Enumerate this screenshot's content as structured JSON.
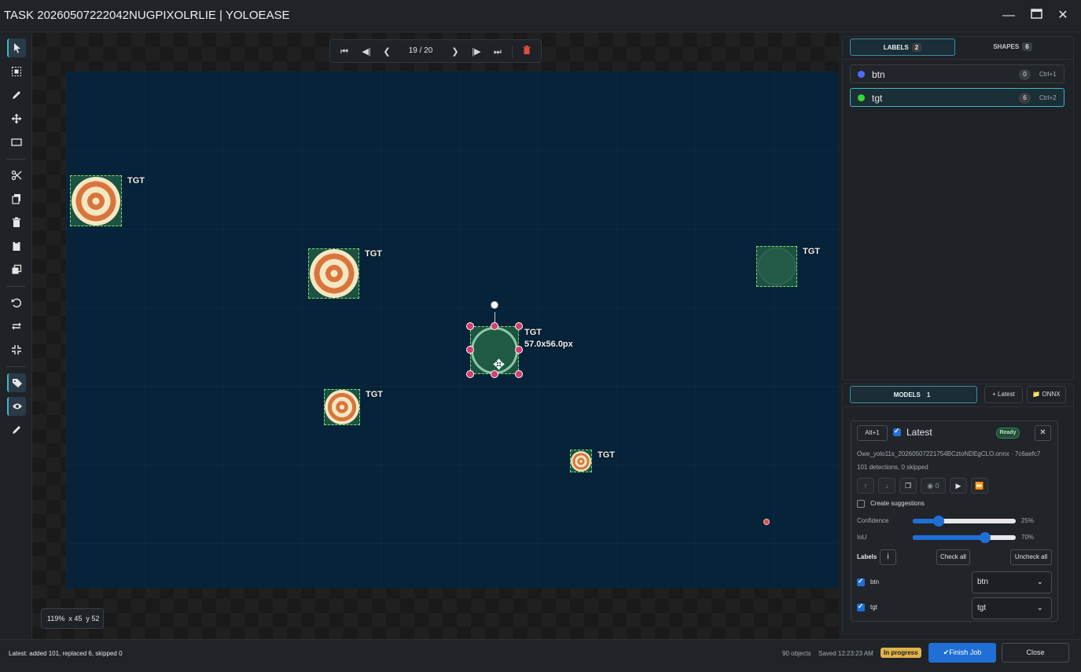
{
  "window": {
    "title": "TASK 20260507222042NUGPIXOLRLIE | YOLOEASE",
    "minimize_icon": "minimize-icon",
    "maximize_icon": "maximize-icon",
    "close_icon": "close-icon"
  },
  "toolbar": {
    "tools": [
      "pointer-tool",
      "select-area-tool",
      "draw-tool",
      "move-tool",
      "rectangle-tool",
      "cut-tool",
      "copy-tool",
      "delete-tool",
      "paste-tool",
      "duplicate-tool",
      "undo-tool",
      "redo-tool",
      "fit-tool",
      "labels-toggle",
      "visibility-toggle",
      "brush-tool"
    ]
  },
  "navigator": {
    "counter": "19 / 20"
  },
  "canvas": {
    "selected_size": "57.0x56.0px",
    "zoom": {
      "percent": "119%",
      "x": "x 45",
      "y": "y 52"
    },
    "annotations": [
      "TGT",
      "TGT",
      "TGT",
      "TGT",
      "TGT",
      "TGT"
    ]
  },
  "labels_panel": {
    "tabs": [
      {
        "label": "LABELS",
        "count": "2"
      },
      {
        "label": "SHAPES",
        "count": "6"
      }
    ],
    "items": [
      {
        "name": "btn",
        "count": "0",
        "shortcut": "Ctrl+1",
        "color": "#4f6bff"
      },
      {
        "name": "tgt",
        "count": "6",
        "shortcut": "Ctrl+2",
        "color": "#35d635"
      }
    ]
  },
  "models_panel": {
    "tab": {
      "label": "MODELS",
      "count": "1"
    },
    "latest_button": "+ Latest",
    "onnx_button": "ONNX",
    "card": {
      "shortcut": "Alt+1",
      "name": "Latest",
      "status": "Ready",
      "file": "Owe_yolo11s_20260507221754BCztoNDEgCLO.onnx · 7c6aefc7",
      "stats": "101 detections, 0 skipped",
      "hidden_count": "0",
      "create_suggestions": "Create suggestions",
      "confidence_label": "Confidence",
      "confidence_value": "25%",
      "confidence": 0.25,
      "iou_label": "IoU",
      "iou_value": "70%",
      "iou": 0.7,
      "labels_title": "Labels",
      "check_all": "Check all",
      "uncheck_all": "Uncheck all",
      "label_maps": [
        {
          "name": "btn",
          "target": "btn"
        },
        {
          "name": "tgt",
          "target": "tgt"
        }
      ]
    }
  },
  "statusbar": {
    "message": "Latest: added 101, replaced 6, skipped 0",
    "objects": "90 objects",
    "saved": "Saved 12:23:23 AM",
    "state": "In progress",
    "finish": "Finish Job",
    "close": "Close"
  },
  "colors": {
    "accent": "#3fb5c8",
    "primary": "#1f6fd6",
    "handle": "#d63b6e",
    "bbox": "#7fe36b",
    "warning": "#e0b34a",
    "ready": "#2f8a5b"
  }
}
